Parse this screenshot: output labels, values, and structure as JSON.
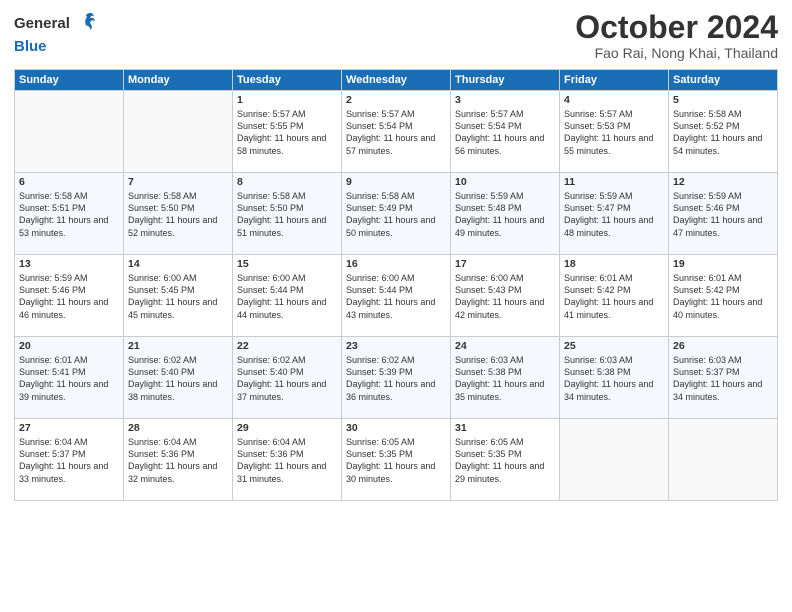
{
  "header": {
    "logo_general": "General",
    "logo_blue": "Blue",
    "month_title": "October 2024",
    "location": "Fao Rai, Nong Khai, Thailand"
  },
  "weekdays": [
    "Sunday",
    "Monday",
    "Tuesday",
    "Wednesday",
    "Thursday",
    "Friday",
    "Saturday"
  ],
  "weeks": [
    [
      {
        "day": "",
        "info": ""
      },
      {
        "day": "",
        "info": ""
      },
      {
        "day": "1",
        "info": "Sunrise: 5:57 AM\nSunset: 5:55 PM\nDaylight: 11 hours and 58 minutes."
      },
      {
        "day": "2",
        "info": "Sunrise: 5:57 AM\nSunset: 5:54 PM\nDaylight: 11 hours and 57 minutes."
      },
      {
        "day": "3",
        "info": "Sunrise: 5:57 AM\nSunset: 5:54 PM\nDaylight: 11 hours and 56 minutes."
      },
      {
        "day": "4",
        "info": "Sunrise: 5:57 AM\nSunset: 5:53 PM\nDaylight: 11 hours and 55 minutes."
      },
      {
        "day": "5",
        "info": "Sunrise: 5:58 AM\nSunset: 5:52 PM\nDaylight: 11 hours and 54 minutes."
      }
    ],
    [
      {
        "day": "6",
        "info": "Sunrise: 5:58 AM\nSunset: 5:51 PM\nDaylight: 11 hours and 53 minutes."
      },
      {
        "day": "7",
        "info": "Sunrise: 5:58 AM\nSunset: 5:50 PM\nDaylight: 11 hours and 52 minutes."
      },
      {
        "day": "8",
        "info": "Sunrise: 5:58 AM\nSunset: 5:50 PM\nDaylight: 11 hours and 51 minutes."
      },
      {
        "day": "9",
        "info": "Sunrise: 5:58 AM\nSunset: 5:49 PM\nDaylight: 11 hours and 50 minutes."
      },
      {
        "day": "10",
        "info": "Sunrise: 5:59 AM\nSunset: 5:48 PM\nDaylight: 11 hours and 49 minutes."
      },
      {
        "day": "11",
        "info": "Sunrise: 5:59 AM\nSunset: 5:47 PM\nDaylight: 11 hours and 48 minutes."
      },
      {
        "day": "12",
        "info": "Sunrise: 5:59 AM\nSunset: 5:46 PM\nDaylight: 11 hours and 47 minutes."
      }
    ],
    [
      {
        "day": "13",
        "info": "Sunrise: 5:59 AM\nSunset: 5:46 PM\nDaylight: 11 hours and 46 minutes."
      },
      {
        "day": "14",
        "info": "Sunrise: 6:00 AM\nSunset: 5:45 PM\nDaylight: 11 hours and 45 minutes."
      },
      {
        "day": "15",
        "info": "Sunrise: 6:00 AM\nSunset: 5:44 PM\nDaylight: 11 hours and 44 minutes."
      },
      {
        "day": "16",
        "info": "Sunrise: 6:00 AM\nSunset: 5:44 PM\nDaylight: 11 hours and 43 minutes."
      },
      {
        "day": "17",
        "info": "Sunrise: 6:00 AM\nSunset: 5:43 PM\nDaylight: 11 hours and 42 minutes."
      },
      {
        "day": "18",
        "info": "Sunrise: 6:01 AM\nSunset: 5:42 PM\nDaylight: 11 hours and 41 minutes."
      },
      {
        "day": "19",
        "info": "Sunrise: 6:01 AM\nSunset: 5:42 PM\nDaylight: 11 hours and 40 minutes."
      }
    ],
    [
      {
        "day": "20",
        "info": "Sunrise: 6:01 AM\nSunset: 5:41 PM\nDaylight: 11 hours and 39 minutes."
      },
      {
        "day": "21",
        "info": "Sunrise: 6:02 AM\nSunset: 5:40 PM\nDaylight: 11 hours and 38 minutes."
      },
      {
        "day": "22",
        "info": "Sunrise: 6:02 AM\nSunset: 5:40 PM\nDaylight: 11 hours and 37 minutes."
      },
      {
        "day": "23",
        "info": "Sunrise: 6:02 AM\nSunset: 5:39 PM\nDaylight: 11 hours and 36 minutes."
      },
      {
        "day": "24",
        "info": "Sunrise: 6:03 AM\nSunset: 5:38 PM\nDaylight: 11 hours and 35 minutes."
      },
      {
        "day": "25",
        "info": "Sunrise: 6:03 AM\nSunset: 5:38 PM\nDaylight: 11 hours and 34 minutes."
      },
      {
        "day": "26",
        "info": "Sunrise: 6:03 AM\nSunset: 5:37 PM\nDaylight: 11 hours and 34 minutes."
      }
    ],
    [
      {
        "day": "27",
        "info": "Sunrise: 6:04 AM\nSunset: 5:37 PM\nDaylight: 11 hours and 33 minutes."
      },
      {
        "day": "28",
        "info": "Sunrise: 6:04 AM\nSunset: 5:36 PM\nDaylight: 11 hours and 32 minutes."
      },
      {
        "day": "29",
        "info": "Sunrise: 6:04 AM\nSunset: 5:36 PM\nDaylight: 11 hours and 31 minutes."
      },
      {
        "day": "30",
        "info": "Sunrise: 6:05 AM\nSunset: 5:35 PM\nDaylight: 11 hours and 30 minutes."
      },
      {
        "day": "31",
        "info": "Sunrise: 6:05 AM\nSunset: 5:35 PM\nDaylight: 11 hours and 29 minutes."
      },
      {
        "day": "",
        "info": ""
      },
      {
        "day": "",
        "info": ""
      }
    ]
  ]
}
